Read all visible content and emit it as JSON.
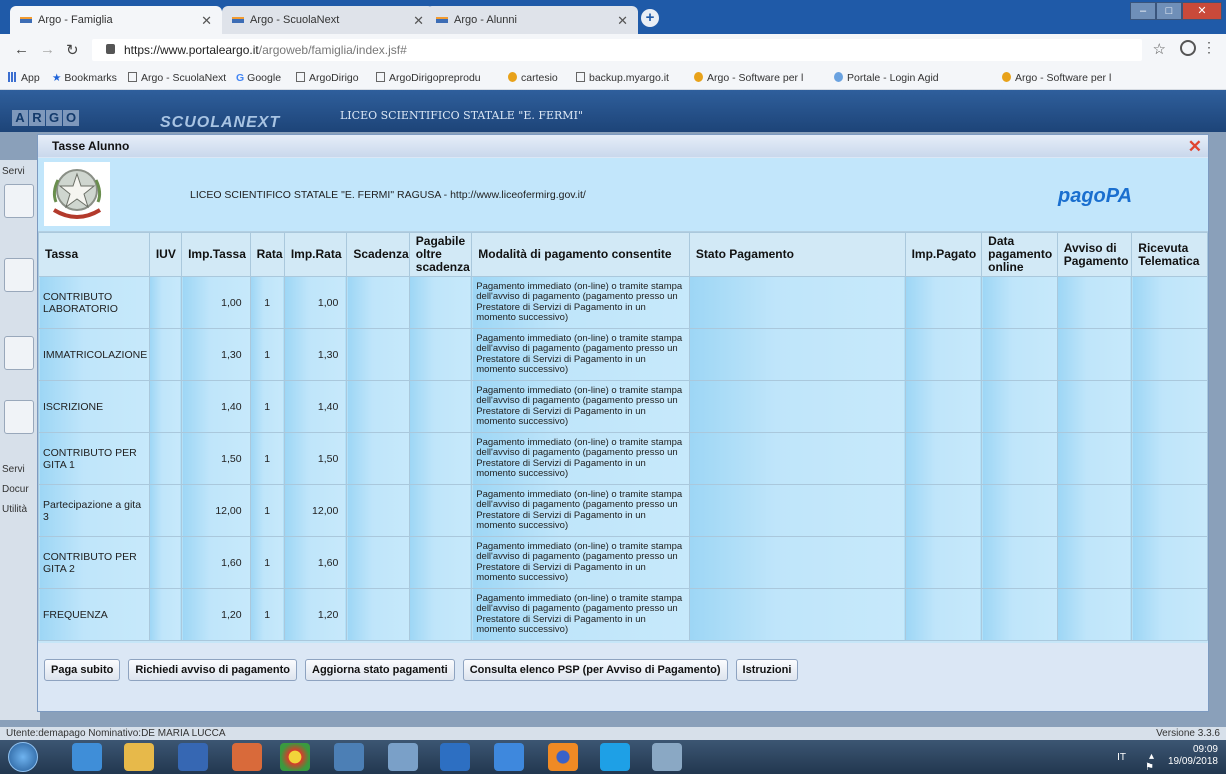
{
  "browser": {
    "tabs": [
      {
        "title": "Argo - Famiglia"
      },
      {
        "title": "Argo - ScuolaNext"
      },
      {
        "title": "Argo - Alunni"
      }
    ],
    "url_host": "https://www.portaleargo.it",
    "url_path": "/argoweb/famiglia/index.jsf#",
    "bookmarks": [
      "App",
      "Bookmarks",
      "Argo - ScuolaNext",
      "Google",
      "ArgoDirigo",
      "ArgoDirigopreprodu",
      "cartesio",
      "backup.myargo.it",
      "Argo - Software per l",
      "Portale - Login Agid",
      "Argo - Software per l"
    ]
  },
  "app": {
    "logo_letters": [
      "A",
      "R",
      "G",
      "O"
    ],
    "product": "SCUOLANEXT",
    "school_header": "LICEO SCIENTIFICO STATALE \"E. FERMI\"",
    "side_labels": [
      "Servi",
      "Servi",
      "Docur",
      "Utilità"
    ],
    "status_user": "Utente:demapago Nominativo:DE MARIA LUCCA",
    "version": "Versione 3.3.6"
  },
  "modal": {
    "title": "Tasse Alunno",
    "banner_text": "LICEO SCIENTIFICO STATALE \"E. FERMI\" RAGUSA - http://www.liceofermirg.gov.it/",
    "pagopa_logo": "pagoPA",
    "columns": [
      "Tassa",
      "IUV",
      "Imp.Tassa",
      "Rata",
      "Imp.Rata",
      "Scadenza",
      "Pagabile oltre scadenza",
      "Modalità di pagamento consentite",
      "Stato Pagamento",
      "Imp.Pagato",
      "Data pagamento online",
      "Avviso di Pagamento",
      "Ricevuta Telematica"
    ],
    "rows": [
      {
        "tassa": "CONTRIBUTO LABORATORIO",
        "iuv": "",
        "imp_tassa": "1,00",
        "rata": "1",
        "imp_rata": "1,00",
        "scadenza": "",
        "pagabile": "",
        "modalita": "Pagamento immediato (on-line) o tramite stampa dell'avviso di pagamento (pagamento presso un Prestatore di Servizi di Pagamento in un momento successivo)",
        "stato": "",
        "imp_pagato": "",
        "data_pag": "",
        "avviso": "",
        "ricevuta": ""
      },
      {
        "tassa": "IMMATRICOLAZIONE",
        "iuv": "",
        "imp_tassa": "1,30",
        "rata": "1",
        "imp_rata": "1,30",
        "scadenza": "",
        "pagabile": "",
        "modalita": "Pagamento immediato (on-line) o tramite stampa dell'avviso di pagamento (pagamento presso un Prestatore di Servizi di Pagamento in un momento successivo)",
        "stato": "",
        "imp_pagato": "",
        "data_pag": "",
        "avviso": "",
        "ricevuta": ""
      },
      {
        "tassa": "ISCRIZIONE",
        "iuv": "",
        "imp_tassa": "1,40",
        "rata": "1",
        "imp_rata": "1,40",
        "scadenza": "",
        "pagabile": "",
        "modalita": "Pagamento immediato (on-line) o tramite stampa dell'avviso di pagamento (pagamento presso un Prestatore di Servizi di Pagamento in un momento successivo)",
        "stato": "",
        "imp_pagato": "",
        "data_pag": "",
        "avviso": "",
        "ricevuta": ""
      },
      {
        "tassa": "CONTRIBUTO PER GITA 1",
        "iuv": "",
        "imp_tassa": "1,50",
        "rata": "1",
        "imp_rata": "1,50",
        "scadenza": "",
        "pagabile": "",
        "modalita": "Pagamento immediato (on-line) o tramite stampa dell'avviso di pagamento (pagamento presso un Prestatore di Servizi di Pagamento in un momento successivo)",
        "stato": "",
        "imp_pagato": "",
        "data_pag": "",
        "avviso": "",
        "ricevuta": ""
      },
      {
        "tassa": "Partecipazione a gita 3",
        "iuv": "",
        "imp_tassa": "12,00",
        "rata": "1",
        "imp_rata": "12,00",
        "scadenza": "",
        "pagabile": "",
        "modalita": "Pagamento immediato (on-line) o tramite stampa dell'avviso di pagamento (pagamento presso un Prestatore di Servizi di Pagamento in un momento successivo)",
        "stato": "",
        "imp_pagato": "",
        "data_pag": "",
        "avviso": "",
        "ricevuta": ""
      },
      {
        "tassa": "CONTRIBUTO PER GITA 2",
        "iuv": "",
        "imp_tassa": "1,60",
        "rata": "1",
        "imp_rata": "1,60",
        "scadenza": "",
        "pagabile": "",
        "modalita": "Pagamento immediato (on-line) o tramite stampa dell'avviso di pagamento (pagamento presso un Prestatore di Servizi di Pagamento in un momento successivo)",
        "stato": "",
        "imp_pagato": "",
        "data_pag": "",
        "avviso": "",
        "ricevuta": ""
      },
      {
        "tassa": "FREQUENZA",
        "iuv": "",
        "imp_tassa": "1,20",
        "rata": "1",
        "imp_rata": "1,20",
        "scadenza": "",
        "pagabile": "",
        "modalita": "Pagamento immediato (on-line) o tramite stampa dell'avviso di pagamento (pagamento presso un Prestatore di Servizi di Pagamento in un momento successivo)",
        "stato": "",
        "imp_pagato": "",
        "data_pag": "",
        "avviso": "",
        "ricevuta": ""
      }
    ],
    "buttons": [
      "Paga subito",
      "Richiedi avviso di pagamento",
      "Aggiorna stato pagamenti",
      "Consulta elenco PSP (per Avviso di Pagamento)",
      "Istruzioni"
    ]
  },
  "taskbar": {
    "lang": "IT",
    "time": "09:09",
    "date": "19/09/2018"
  },
  "colors": {
    "accent": "#1f5aa8",
    "close_red": "#e0452f",
    "pagopa_blue": "#1a6fcf"
  }
}
